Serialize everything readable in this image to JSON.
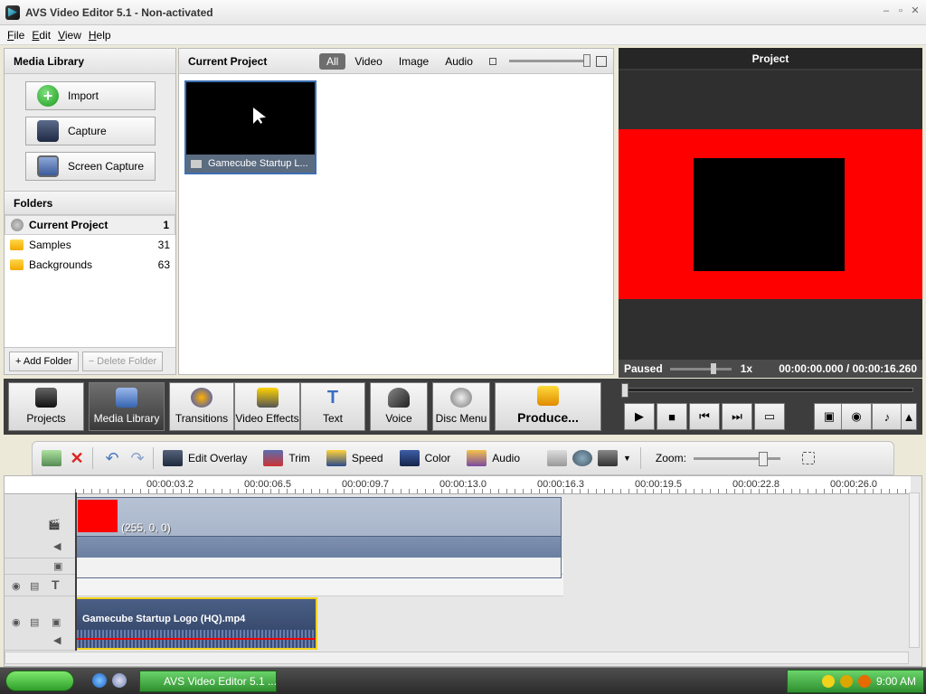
{
  "window": {
    "title": "AVS Video Editor 5.1 - Non-activated"
  },
  "menu": [
    "File",
    "Edit",
    "View",
    "Help"
  ],
  "media_library": {
    "title": "Media Library",
    "buttons": [
      {
        "label": "Import",
        "icon": "import-icon"
      },
      {
        "label": "Capture",
        "icon": "capture-icon"
      },
      {
        "label": "Screen Capture",
        "icon": "screen-capture-icon"
      }
    ],
    "folders_title": "Folders",
    "folders": [
      {
        "name": "Current Project",
        "count": "1",
        "selected": true
      },
      {
        "name": "Samples",
        "count": "31"
      },
      {
        "name": "Backgrounds",
        "count": "63"
      }
    ],
    "add_folder": "Add Folder",
    "delete_folder": "Delete Folder"
  },
  "current_project": {
    "title": "Current Project",
    "filters": [
      "All",
      "Video",
      "Image",
      "Audio"
    ],
    "active_filter": "All",
    "items": [
      {
        "name": "Gamecube Startup L..."
      }
    ]
  },
  "project_preview": {
    "title": "Project",
    "state": "Paused",
    "speed": "1x",
    "time_current": "00:00:00.000",
    "time_separator": "/",
    "time_total": "00:00:16.260"
  },
  "main_toolbar": [
    {
      "label": "Projects",
      "icon": "projects-icon"
    },
    {
      "label": "Media Library",
      "icon": "media-library-icon",
      "active": true
    },
    {
      "label": "Transitions",
      "icon": "transitions-icon"
    },
    {
      "label": "Video Effects",
      "icon": "video-effects-icon"
    },
    {
      "label": "Text",
      "icon": "text-icon"
    },
    {
      "label": "Voice",
      "icon": "voice-icon"
    },
    {
      "label": "Disc Menu",
      "icon": "disc-menu-icon"
    },
    {
      "label": "Produce...",
      "icon": "produce-icon"
    }
  ],
  "timeline_toolbar": {
    "items": [
      "Edit Overlay",
      "Trim",
      "Speed",
      "Color",
      "Audio"
    ],
    "zoom_label": "Zoom:"
  },
  "timeline": {
    "ruler": [
      "00:00:03.2",
      "00:00:06.5",
      "00:00:09.7",
      "00:00:13.0",
      "00:00:16.3",
      "00:00:19.5",
      "00:00:22.8",
      "00:00:26.0"
    ],
    "color_clip_label": "(255, 0, 0)",
    "video_clip_label": "Gamecube Startup Logo (HQ).mp4"
  },
  "taskbar": {
    "task_label": "AVS Video Editor 5.1 ...",
    "clock": "9:00 AM"
  },
  "colors": {
    "accent": "#3d6fb4",
    "preview_bg": "#ff0000",
    "selection": "#f2d21a"
  }
}
